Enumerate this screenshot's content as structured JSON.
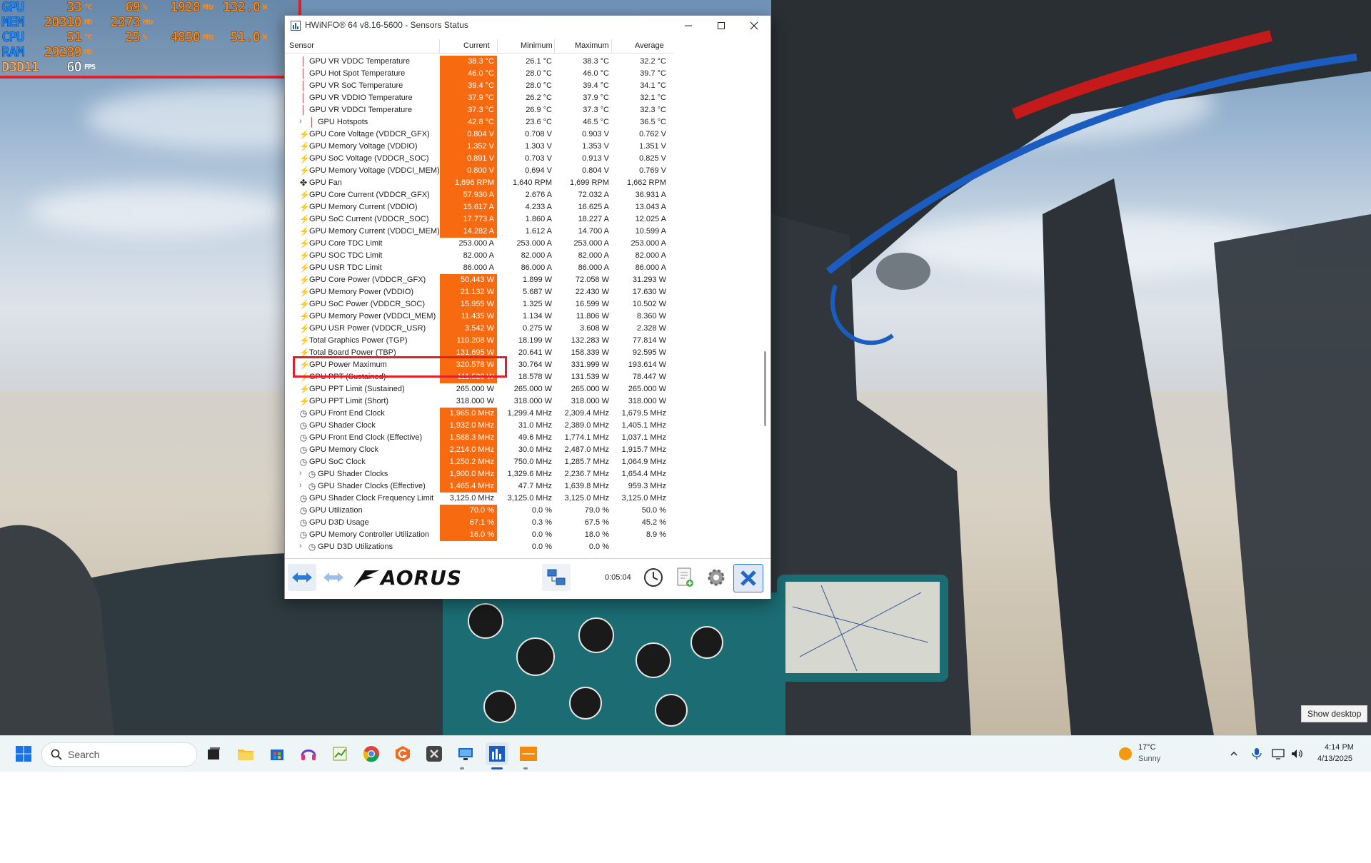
{
  "osd": {
    "rows": [
      {
        "label": "GPU",
        "v1": "33",
        "u1": "°C",
        "v2": "69",
        "u2": "%",
        "v3": "1928",
        "u3": "MHz",
        "v4": "132.0",
        "u4": "W"
      },
      {
        "label": "MEM",
        "v1": "20310",
        "u1": "MB",
        "v2": "2373",
        "u2": "MHz",
        "v3": "",
        "u3": "",
        "v4": "",
        "u4": ""
      },
      {
        "label": "CPU",
        "v1": "51",
        "u1": "°C",
        "v2": "25",
        "u2": "%",
        "v3": "4850",
        "u3": "MHz",
        "v4": "51.0",
        "u4": "W"
      },
      {
        "label": "RAM",
        "v1": "29289",
        "u1": "MB",
        "v2": "",
        "u2": "",
        "v3": "",
        "u3": "",
        "v4": "",
        "u4": ""
      },
      {
        "label": "D3D11",
        "v1": "60",
        "u1": "FPS",
        "v2": "",
        "u2": "",
        "v3": "",
        "u3": "",
        "v4": "",
        "u4": ""
      }
    ]
  },
  "window": {
    "title": "HWiNFO® 64 v8.16-5600 - Sensors Status",
    "minimize_icon": "minimize-icon",
    "maximize_icon": "maximize-icon",
    "close_icon": "close-icon"
  },
  "columns": {
    "sensor": "Sensor",
    "current": "Current",
    "minimum": "Minimum",
    "maximum": "Maximum",
    "average": "Average"
  },
  "rows": [
    {
      "icon": "temp",
      "indent": false,
      "expand": false,
      "name": "GPU VR VDDC Temperature",
      "cur": "38.3 °C",
      "min": "26.1 °C",
      "max": "38.3 °C",
      "avg": "32.2 °C",
      "hi": true
    },
    {
      "icon": "temp",
      "indent": false,
      "expand": false,
      "name": "GPU Hot Spot Temperature",
      "cur": "46.0 °C",
      "min": "28.0 °C",
      "max": "46.0 °C",
      "avg": "39.7 °C",
      "hi": true
    },
    {
      "icon": "temp",
      "indent": false,
      "expand": false,
      "name": "GPU VR SoC Temperature",
      "cur": "39.4 °C",
      "min": "28.0 °C",
      "max": "39.4 °C",
      "avg": "34.1 °C",
      "hi": true
    },
    {
      "icon": "temp",
      "indent": false,
      "expand": false,
      "name": "GPU VR VDDIO Temperature",
      "cur": "37.9 °C",
      "min": "26.2 °C",
      "max": "37.9 °C",
      "avg": "32.1 °C",
      "hi": true
    },
    {
      "icon": "temp",
      "indent": false,
      "expand": false,
      "name": "GPU VR VDDCI Temperature",
      "cur": "37.3 °C",
      "min": "26.9 °C",
      "max": "37.3 °C",
      "avg": "32.3 °C",
      "hi": true
    },
    {
      "icon": "temp",
      "indent": true,
      "expand": true,
      "name": "GPU Hotspots",
      "cur": "42.8 °C",
      "min": "23.6 °C",
      "max": "46.5 °C",
      "avg": "36.5 °C",
      "hi": true
    },
    {
      "icon": "volt",
      "indent": false,
      "expand": false,
      "name": "GPU Core Voltage (VDDCR_GFX)",
      "cur": "0.804 V",
      "min": "0.708 V",
      "max": "0.903 V",
      "avg": "0.762 V",
      "hi": true
    },
    {
      "icon": "volt",
      "indent": false,
      "expand": false,
      "name": "GPU Memory Voltage (VDDIO)",
      "cur": "1.352 V",
      "min": "1.303 V",
      "max": "1.353 V",
      "avg": "1.351 V",
      "hi": true
    },
    {
      "icon": "volt",
      "indent": false,
      "expand": false,
      "name": "GPU SoC Voltage (VDDCR_SOC)",
      "cur": "0.891 V",
      "min": "0.703 V",
      "max": "0.913 V",
      "avg": "0.825 V",
      "hi": true
    },
    {
      "icon": "volt",
      "indent": false,
      "expand": false,
      "name": "GPU Memory Voltage (VDDCI_MEM)",
      "cur": "0.800 V",
      "min": "0.694 V",
      "max": "0.804 V",
      "avg": "0.769 V",
      "hi": true
    },
    {
      "icon": "fan",
      "indent": false,
      "expand": false,
      "name": "GPU Fan",
      "cur": "1,696 RPM",
      "min": "1,640 RPM",
      "max": "1,699 RPM",
      "avg": "1,662 RPM",
      "hi": true
    },
    {
      "icon": "volt",
      "indent": false,
      "expand": false,
      "name": "GPU Core Current (VDDCR_GFX)",
      "cur": "57.930 A",
      "min": "2.676 A",
      "max": "72.032 A",
      "avg": "36.931 A",
      "hi": true
    },
    {
      "icon": "volt",
      "indent": false,
      "expand": false,
      "name": "GPU Memory Current (VDDIO)",
      "cur": "15.617 A",
      "min": "4.233 A",
      "max": "16.625 A",
      "avg": "13.043 A",
      "hi": true
    },
    {
      "icon": "volt",
      "indent": false,
      "expand": false,
      "name": "GPU SoC Current (VDDCR_SOC)",
      "cur": "17.773 A",
      "min": "1.860 A",
      "max": "18.227 A",
      "avg": "12.025 A",
      "hi": true
    },
    {
      "icon": "volt",
      "indent": false,
      "expand": false,
      "name": "GPU Memory Current (VDDCI_MEM)",
      "cur": "14.282 A",
      "min": "1.612 A",
      "max": "14.700 A",
      "avg": "10.599 A",
      "hi": true
    },
    {
      "icon": "volt",
      "indent": false,
      "expand": false,
      "name": "GPU Core TDC Limit",
      "cur": "253.000 A",
      "min": "253.000 A",
      "max": "253.000 A",
      "avg": "253.000 A",
      "hi": false
    },
    {
      "icon": "volt",
      "indent": false,
      "expand": false,
      "name": "GPU SOC TDC Limit",
      "cur": "82.000 A",
      "min": "82.000 A",
      "max": "82.000 A",
      "avg": "82.000 A",
      "hi": false
    },
    {
      "icon": "volt",
      "indent": false,
      "expand": false,
      "name": "GPU USR TDC Limit",
      "cur": "86.000 A",
      "min": "86.000 A",
      "max": "86.000 A",
      "avg": "86.000 A",
      "hi": false
    },
    {
      "icon": "volt",
      "indent": false,
      "expand": false,
      "name": "GPU Core Power (VDDCR_GFX)",
      "cur": "50.443 W",
      "min": "1.899 W",
      "max": "72.058 W",
      "avg": "31.293 W",
      "hi": true
    },
    {
      "icon": "volt",
      "indent": false,
      "expand": false,
      "name": "GPU Memory Power (VDDIO)",
      "cur": "21.132 W",
      "min": "5.687 W",
      "max": "22.430 W",
      "avg": "17.630 W",
      "hi": true
    },
    {
      "icon": "volt",
      "indent": false,
      "expand": false,
      "name": "GPU SoC Power (VDDCR_SOC)",
      "cur": "15.955 W",
      "min": "1.325 W",
      "max": "16.599 W",
      "avg": "10.502 W",
      "hi": true
    },
    {
      "icon": "volt",
      "indent": false,
      "expand": false,
      "name": "GPU Memory Power (VDDCI_MEM)",
      "cur": "11.435 W",
      "min": "1.134 W",
      "max": "11.806 W",
      "avg": "8.360 W",
      "hi": true
    },
    {
      "icon": "volt",
      "indent": false,
      "expand": false,
      "name": "GPU USR Power (VDDCR_USR)",
      "cur": "3.542 W",
      "min": "0.275 W",
      "max": "3.608 W",
      "avg": "2.328 W",
      "hi": true
    },
    {
      "icon": "volt",
      "indent": false,
      "expand": false,
      "name": "Total Graphics Power (TGP)",
      "cur": "110.208 W",
      "min": "18.199 W",
      "max": "132.283 W",
      "avg": "77.814 W",
      "hi": true
    },
    {
      "icon": "volt",
      "indent": false,
      "expand": false,
      "name": "Total Board Power (TBP)",
      "cur": "131.695 W",
      "min": "20.641 W",
      "max": "158.339 W",
      "avg": "92.595 W",
      "hi": true
    },
    {
      "icon": "volt",
      "indent": false,
      "expand": false,
      "name": "GPU Power Maximum",
      "cur": "320.578 W",
      "min": "30.764 W",
      "max": "331.999 W",
      "avg": "193.614 W",
      "hi": true
    },
    {
      "icon": "volt",
      "indent": false,
      "expand": false,
      "name": "GPU PPT (Sustained)",
      "cur": "111.520 W",
      "min": "18.578 W",
      "max": "131.539 W",
      "avg": "78.447 W",
      "hi": true
    },
    {
      "icon": "volt",
      "indent": false,
      "expand": false,
      "name": "GPU PPT Limit (Sustained)",
      "cur": "265.000 W",
      "min": "265.000 W",
      "max": "265.000 W",
      "avg": "265.000 W",
      "hi": false
    },
    {
      "icon": "volt",
      "indent": false,
      "expand": false,
      "name": "GPU PPT Limit (Short)",
      "cur": "318.000 W",
      "min": "318.000 W",
      "max": "318.000 W",
      "avg": "318.000 W",
      "hi": false
    },
    {
      "icon": "clock",
      "indent": false,
      "expand": false,
      "name": "GPU Front End Clock",
      "cur": "1,965.0 MHz",
      "min": "1,299.4 MHz",
      "max": "2,309.4 MHz",
      "avg": "1,679.5 MHz",
      "hi": true
    },
    {
      "icon": "clock",
      "indent": false,
      "expand": false,
      "name": "GPU Shader Clock",
      "cur": "1,932.0 MHz",
      "min": "31.0 MHz",
      "max": "2,389.0 MHz",
      "avg": "1,405.1 MHz",
      "hi": true
    },
    {
      "icon": "clock",
      "indent": false,
      "expand": false,
      "name": "GPU Front End Clock (Effective)",
      "cur": "1,588.3 MHz",
      "min": "49.6 MHz",
      "max": "1,774.1 MHz",
      "avg": "1,037.1 MHz",
      "hi": true
    },
    {
      "icon": "clock",
      "indent": false,
      "expand": false,
      "name": "GPU Memory Clock",
      "cur": "2,214.0 MHz",
      "min": "30.0 MHz",
      "max": "2,487.0 MHz",
      "avg": "1,915.7 MHz",
      "hi": true
    },
    {
      "icon": "clock",
      "indent": false,
      "expand": false,
      "name": "GPU SoC Clock",
      "cur": "1,250.2 MHz",
      "min": "750.0 MHz",
      "max": "1,285.7 MHz",
      "avg": "1,064.9 MHz",
      "hi": true
    },
    {
      "icon": "clock",
      "indent": true,
      "expand": true,
      "name": "GPU Shader Clocks",
      "cur": "1,900.0 MHz",
      "min": "1,329.6 MHz",
      "max": "2,236.7 MHz",
      "avg": "1,654.4 MHz",
      "hi": true
    },
    {
      "icon": "clock",
      "indent": true,
      "expand": true,
      "name": "GPU Shader Clocks (Effective)",
      "cur": "1,465.4 MHz",
      "min": "47.7 MHz",
      "max": "1,639.8 MHz",
      "avg": "959.3 MHz",
      "hi": true
    },
    {
      "icon": "clock",
      "indent": false,
      "expand": false,
      "name": "GPU Shader Clock Frequency Limit",
      "cur": "3,125.0 MHz",
      "min": "3,125.0 MHz",
      "max": "3,125.0 MHz",
      "avg": "3,125.0 MHz",
      "hi": false
    },
    {
      "icon": "clock",
      "indent": false,
      "expand": false,
      "name": "GPU Utilization",
      "cur": "70.0 %",
      "min": "0.0 %",
      "max": "79.0 %",
      "avg": "50.0 %",
      "hi": true
    },
    {
      "icon": "clock",
      "indent": false,
      "expand": false,
      "name": "GPU D3D Usage",
      "cur": "67.1 %",
      "min": "0.3 %",
      "max": "67.5 %",
      "avg": "45.2 %",
      "hi": true
    },
    {
      "icon": "clock",
      "indent": false,
      "expand": false,
      "name": "GPU Memory Controller Utilization",
      "cur": "16.0 %",
      "min": "0.0 %",
      "max": "18.0 %",
      "avg": "8.9 %",
      "hi": true
    },
    {
      "icon": "clock",
      "indent": true,
      "expand": true,
      "name": "GPU D3D Utilizations",
      "cur": "",
      "min": "0.0 %",
      "max": "0.0 %",
      "avg": "",
      "hi": false
    }
  ],
  "footer": {
    "logo_text": "AORUS",
    "timer": "0:05:04"
  },
  "show_desktop": "Show desktop",
  "taskbar": {
    "search_placeholder": "Search",
    "weather_temp": "17°C",
    "weather_cond": "Sunny",
    "time": "4:14 PM",
    "date": "4/13/2025"
  },
  "colors": {
    "highlight_cell": "#f86a10",
    "annotation_red": "#e0202a",
    "osd_label": "#1a8cff",
    "osd_value": "#ff8a12"
  }
}
